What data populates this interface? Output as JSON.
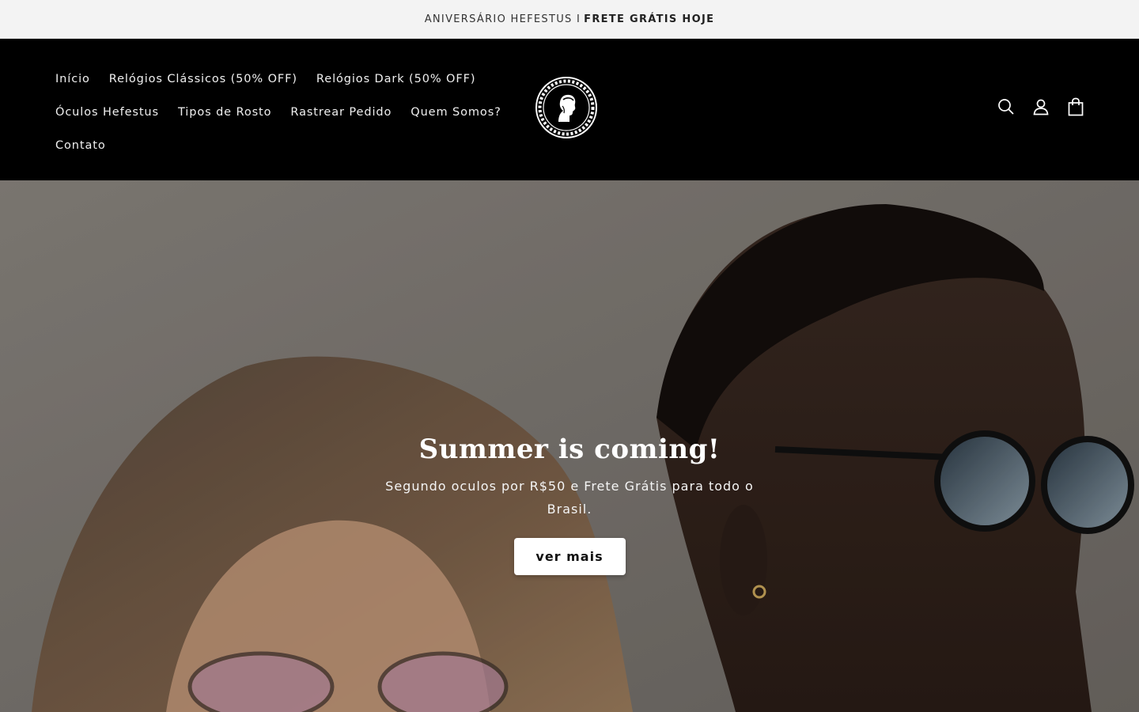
{
  "announcement": {
    "text": "ANIVERSÁRIO HEFESTUS I",
    "highlight": "FRETE GRÁTIS HOJE"
  },
  "nav": {
    "rows": [
      [
        "Início",
        "Relógios Clássicos (50% OFF)",
        "Relógios Dark (50% OFF)"
      ],
      [
        "Óculos Hefestus",
        "Tipos de Rosto",
        "Rastrear Pedido",
        "Quem Somos?"
      ],
      [
        "Contato"
      ]
    ],
    "icons": [
      "search-icon",
      "account-icon",
      "cart-icon"
    ]
  },
  "hero": {
    "title": "Summer is coming!",
    "subtitle": "Segundo oculos por R$50 e Frete Grátis para todo o Brasil.",
    "button": "ver mais"
  },
  "colors": {
    "announcement_bg": "#f3f3f3",
    "header_bg": "#000000",
    "button_bg": "#ffffff"
  }
}
